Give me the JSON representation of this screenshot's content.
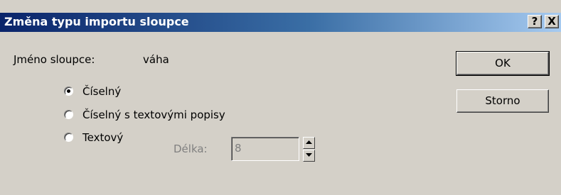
{
  "window": {
    "title": "Změna typu importu sloupce",
    "help_button": "?",
    "close_button": "X"
  },
  "column": {
    "label": "Jméno sloupce:",
    "name": "váha"
  },
  "radios": [
    {
      "label": "Číselný",
      "selected": true
    },
    {
      "label": "Číselný s textovými popisy",
      "selected": false
    },
    {
      "label": "Textový",
      "selected": false
    }
  ],
  "length": {
    "label": "Délka:",
    "value": "8",
    "enabled": false
  },
  "buttons": {
    "ok": "OK",
    "cancel": "Storno"
  },
  "colors": {
    "titlebar_start": "#0a246a",
    "titlebar_end": "#a6caf0",
    "face": "#d4d0c8",
    "disabled_text": "#808080"
  }
}
